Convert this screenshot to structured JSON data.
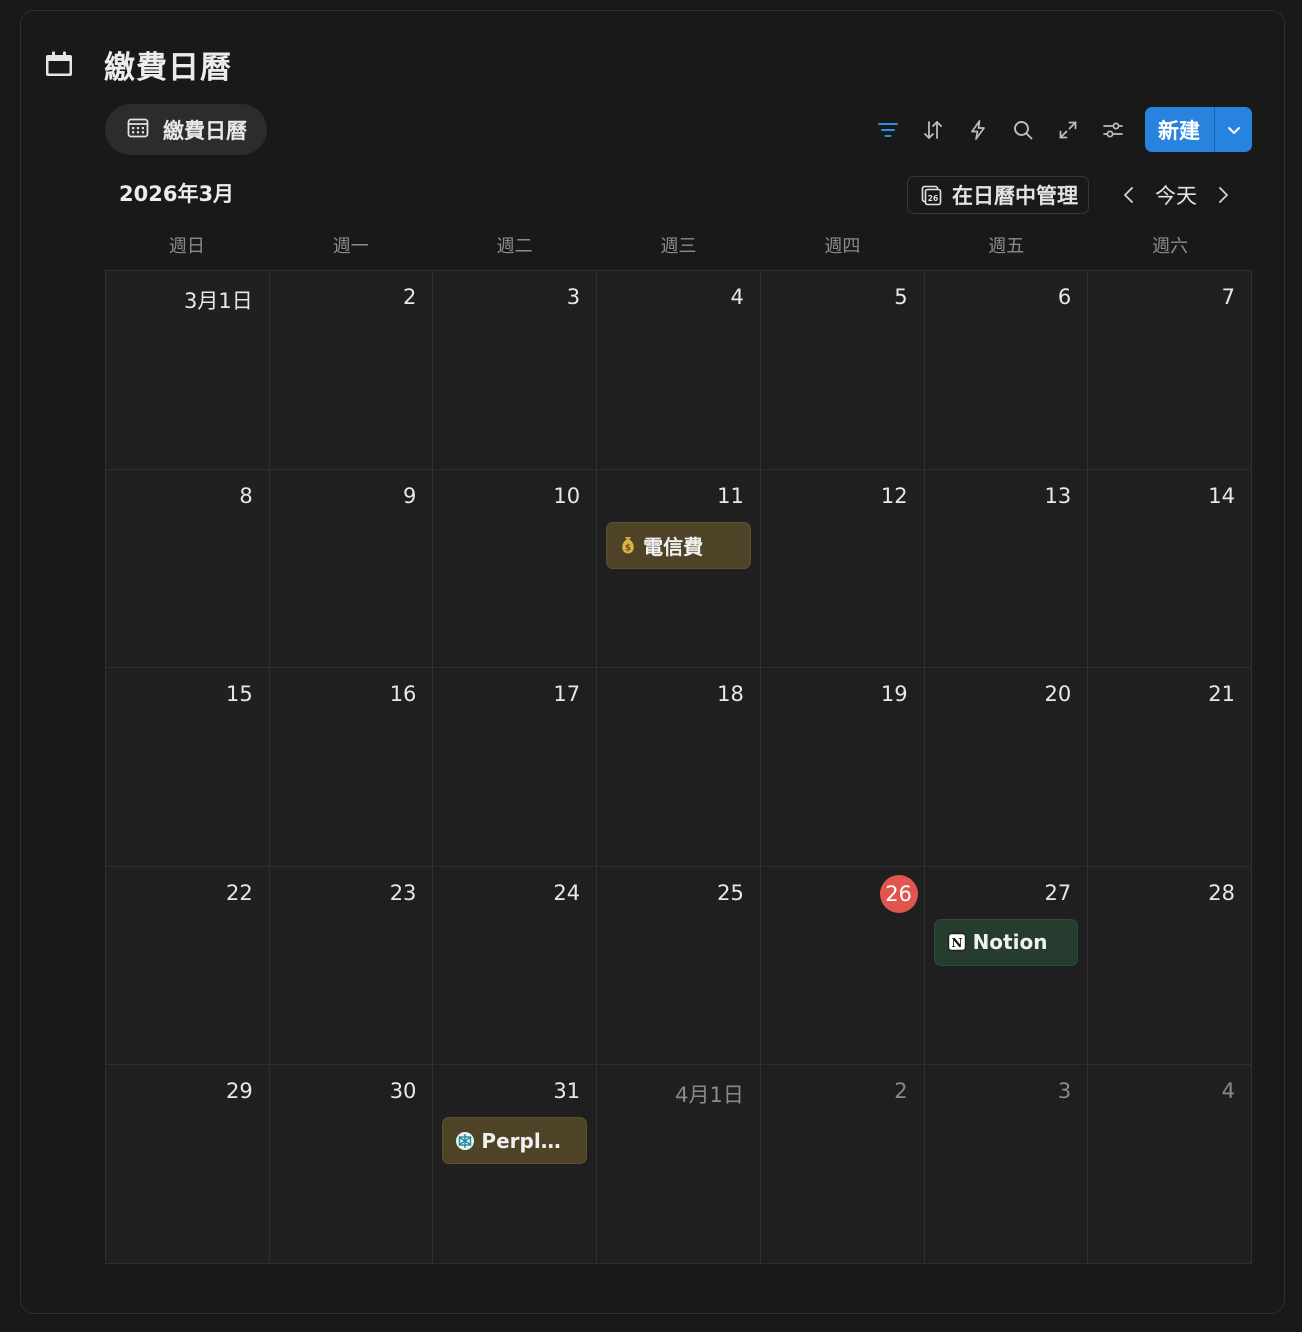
{
  "page": {
    "title": "繳費日曆"
  },
  "view_chip": {
    "label": "繳費日曆"
  },
  "toolbar": {
    "icons": [
      "filter-icon",
      "sort-icon",
      "automation-icon",
      "search-icon",
      "expand-icon",
      "settings-icon"
    ],
    "new_label": "新建",
    "accent": "#2783de"
  },
  "calendar": {
    "month_label": "2026年3月",
    "manage_label": "在日曆中管理",
    "today_label": "今天",
    "weekdays": [
      "週日",
      "週一",
      "週二",
      "週三",
      "週四",
      "週五",
      "週六"
    ],
    "today_color": "#e0554d",
    "days": [
      {
        "label": "3月1日"
      },
      {
        "label": "2"
      },
      {
        "label": "3"
      },
      {
        "label": "4"
      },
      {
        "label": "5"
      },
      {
        "label": "6"
      },
      {
        "label": "7"
      },
      {
        "label": "8"
      },
      {
        "label": "9"
      },
      {
        "label": "10"
      },
      {
        "label": "11",
        "event": {
          "icon": "money-bag-icon",
          "title": "電信費",
          "color": "brown"
        }
      },
      {
        "label": "12"
      },
      {
        "label": "13"
      },
      {
        "label": "14"
      },
      {
        "label": "15"
      },
      {
        "label": "16"
      },
      {
        "label": "17"
      },
      {
        "label": "18"
      },
      {
        "label": "19"
      },
      {
        "label": "20"
      },
      {
        "label": "21"
      },
      {
        "label": "22"
      },
      {
        "label": "23"
      },
      {
        "label": "24"
      },
      {
        "label": "25"
      },
      {
        "label": "26",
        "today": true
      },
      {
        "label": "27",
        "event": {
          "icon": "notion-icon",
          "title": "Notion",
          "color": "green"
        }
      },
      {
        "label": "28"
      },
      {
        "label": "29"
      },
      {
        "label": "30"
      },
      {
        "label": "31",
        "event": {
          "icon": "perplexity-icon",
          "title": "Perple...",
          "color": "brown"
        }
      },
      {
        "label": "4月1日",
        "other": true
      },
      {
        "label": "2",
        "other": true
      },
      {
        "label": "3",
        "other": true
      },
      {
        "label": "4",
        "other": true
      }
    ]
  }
}
